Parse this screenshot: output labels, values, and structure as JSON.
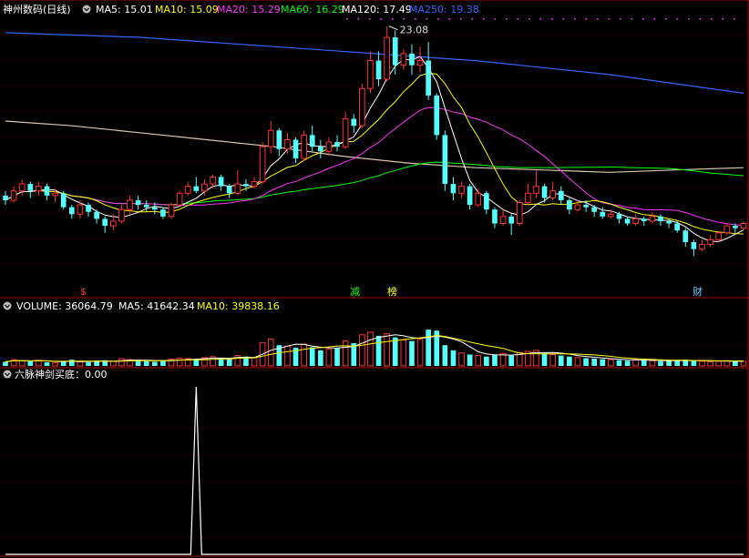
{
  "stock": {
    "name": "神州数码",
    "period": "(日线)"
  },
  "price_panel": {
    "ma_labels": [
      {
        "text": "MA5: 15.01",
        "color": "#ffffff"
      },
      {
        "text": "MA10: 15.09",
        "color": "#ffff00"
      },
      {
        "text": "MA20: 15.29",
        "color": "#ff33ff"
      },
      {
        "text": "MA60: 16.29",
        "color": "#00ff00"
      },
      {
        "text": "MA120: 17.49",
        "color": "#ffffff"
      },
      {
        "text": "MA250: 19.38",
        "color": "#3366ff"
      }
    ],
    "high_label": "23.08",
    "markers": [
      {
        "text": "$",
        "color": "#ff3333"
      },
      {
        "text": "减",
        "color": "#00ff00"
      },
      {
        "text": "榜",
        "color": "#ffff00"
      },
      {
        "text": "财",
        "color": "#66ccff"
      }
    ]
  },
  "volume_panel": {
    "labels": [
      {
        "text": "VOLUME: 36064.79",
        "color": "#ffffff"
      },
      {
        "text": "MA5: 41642.34",
        "color": "#ffffff"
      },
      {
        "text": "MA10: 39838.16",
        "color": "#ffff00"
      }
    ]
  },
  "indicator_panel": {
    "label": "六脉神剑买底：0.00",
    "color": "#ffffff"
  },
  "chart_data": {
    "type": "candlestick",
    "ylim": [
      12,
      23.5
    ],
    "candles": [
      [
        15.8,
        15.6,
        16.0,
        15.4
      ],
      [
        15.6,
        16.0,
        16.2,
        15.5
      ],
      [
        16.0,
        16.3,
        16.5,
        15.8
      ],
      [
        16.3,
        16.0,
        16.4,
        15.7
      ],
      [
        16.0,
        16.2,
        16.4,
        15.8
      ],
      [
        16.2,
        15.8,
        16.3,
        15.6
      ],
      [
        15.8,
        15.9,
        16.1,
        15.5
      ],
      [
        15.9,
        15.3,
        16.0,
        15.2
      ],
      [
        15.3,
        15.0,
        15.4,
        14.8
      ],
      [
        15.0,
        15.4,
        15.6,
        14.8
      ],
      [
        15.4,
        15.1,
        15.5,
        14.9
      ],
      [
        15.1,
        14.8,
        15.2,
        14.6
      ],
      [
        14.8,
        14.5,
        14.9,
        14.2
      ],
      [
        14.5,
        14.7,
        15.0,
        14.3
      ],
      [
        14.7,
        15.2,
        15.4,
        14.6
      ],
      [
        15.2,
        15.6,
        15.8,
        15.0
      ],
      [
        15.6,
        15.4,
        15.8,
        15.2
      ],
      [
        15.4,
        15.3,
        15.6,
        15.1
      ],
      [
        15.3,
        15.2,
        15.5,
        15.0
      ],
      [
        15.2,
        14.9,
        15.3,
        14.8
      ],
      [
        14.9,
        15.4,
        15.5,
        14.8
      ],
      [
        15.4,
        15.9,
        16.0,
        15.3
      ],
      [
        15.9,
        16.2,
        16.4,
        15.8
      ],
      [
        16.2,
        16.0,
        16.6,
        15.9
      ],
      [
        16.0,
        16.3,
        16.5,
        15.8
      ],
      [
        16.3,
        16.6,
        16.7,
        16.1
      ],
      [
        16.6,
        16.2,
        16.7,
        16.0
      ],
      [
        16.2,
        15.9,
        16.3,
        15.7
      ],
      [
        15.9,
        16.3,
        16.9,
        15.8
      ],
      [
        16.3,
        16.2,
        16.5,
        16.0
      ],
      [
        16.2,
        16.4,
        16.6,
        16.1
      ],
      [
        16.4,
        17.9,
        18.1,
        16.3
      ],
      [
        17.9,
        18.6,
        19.0,
        17.6
      ],
      [
        18.6,
        17.8,
        18.7,
        17.5
      ],
      [
        17.8,
        18.2,
        18.5,
        17.6
      ],
      [
        18.2,
        17.4,
        18.3,
        17.2
      ],
      [
        17.4,
        18.4,
        18.6,
        17.3
      ],
      [
        18.4,
        17.9,
        18.8,
        17.7
      ],
      [
        17.9,
        17.7,
        18.2,
        17.4
      ],
      [
        17.7,
        18.1,
        18.3,
        17.5
      ],
      [
        18.1,
        17.9,
        18.4,
        17.7
      ],
      [
        17.9,
        19.1,
        19.4,
        17.8
      ],
      [
        19.1,
        18.8,
        19.3,
        18.5
      ],
      [
        18.8,
        20.4,
        20.6,
        18.7
      ],
      [
        20.4,
        21.6,
        22.0,
        20.2
      ],
      [
        21.6,
        20.8,
        22.0,
        20.5
      ],
      [
        20.8,
        22.6,
        23.08,
        20.7
      ],
      [
        22.6,
        21.4,
        22.9,
        21.0
      ],
      [
        21.4,
        21.9,
        22.1,
        21.2
      ],
      [
        21.9,
        21.4,
        22.3,
        21.0
      ],
      [
        21.4,
        21.6,
        22.2,
        21.1
      ],
      [
        21.6,
        20.1,
        22.4,
        19.9
      ],
      [
        20.1,
        18.4,
        20.2,
        18.2
      ],
      [
        18.4,
        16.3,
        18.6,
        16.0
      ],
      [
        16.3,
        15.9,
        16.6,
        15.6
      ],
      [
        15.9,
        16.2,
        16.4,
        15.7
      ],
      [
        16.2,
        15.4,
        16.3,
        15.2
      ],
      [
        15.4,
        15.9,
        16.1,
        15.3
      ],
      [
        15.9,
        15.2,
        16.0,
        15.0
      ],
      [
        15.2,
        14.6,
        15.3,
        14.4
      ],
      [
        14.6,
        14.9,
        15.2,
        14.5
      ],
      [
        14.9,
        14.6,
        15.0,
        14.1
      ],
      [
        14.6,
        15.5,
        15.6,
        14.5
      ],
      [
        15.5,
        15.9,
        16.3,
        15.4
      ],
      [
        15.9,
        16.2,
        16.9,
        15.7
      ],
      [
        16.2,
        15.7,
        16.3,
        15.5
      ],
      [
        15.7,
        16.0,
        16.4,
        15.6
      ],
      [
        16.0,
        15.6,
        16.2,
        15.4
      ],
      [
        15.6,
        15.2,
        15.7,
        15.0
      ],
      [
        15.2,
        15.4,
        15.6,
        15.1
      ],
      [
        15.4,
        15.3,
        15.6,
        15.1
      ],
      [
        15.3,
        15.1,
        15.4,
        14.9
      ],
      [
        15.1,
        14.9,
        15.3,
        14.8
      ],
      [
        14.9,
        15.0,
        15.2,
        14.8
      ],
      [
        15.0,
        14.8,
        15.1,
        14.6
      ],
      [
        14.8,
        14.6,
        14.9,
        14.5
      ],
      [
        14.6,
        14.8,
        15.0,
        14.5
      ],
      [
        14.8,
        14.7,
        14.9,
        14.5
      ],
      [
        14.7,
        14.9,
        15.1,
        14.6
      ],
      [
        14.9,
        14.7,
        15.0,
        14.5
      ],
      [
        14.7,
        14.6,
        14.8,
        14.4
      ],
      [
        14.6,
        14.3,
        14.7,
        14.2
      ],
      [
        14.3,
        13.8,
        14.4,
        13.6
      ],
      [
        13.8,
        13.5,
        13.9,
        13.2
      ],
      [
        13.5,
        13.7,
        13.9,
        13.4
      ],
      [
        13.7,
        13.9,
        14.1,
        13.6
      ],
      [
        13.9,
        14.2,
        14.3,
        13.8
      ],
      [
        14.2,
        14.5,
        14.6,
        14.1
      ],
      [
        14.5,
        14.4,
        14.6,
        14.2
      ],
      [
        14.4,
        14.6,
        14.7,
        14.3
      ]
    ],
    "ma_series": [
      {
        "name": "MA5",
        "color": "#ffffff"
      },
      {
        "name": "MA10",
        "color": "#ffff00"
      },
      {
        "name": "MA20",
        "color": "#ff33ff"
      },
      {
        "name": "MA60",
        "color": "#00ff00"
      },
      {
        "name": "MA120",
        "color": "#ffffff"
      },
      {
        "name": "MA250",
        "color": "#3366ff"
      }
    ],
    "ma120_points": [
      19.0,
      18.8,
      18.5,
      18.2,
      17.9,
      17.5,
      17.2,
      17.0,
      16.9,
      16.8,
      16.9,
      17.0
    ],
    "ma250_points": [
      22.8,
      22.7,
      22.6,
      22.4,
      22.2,
      22.0,
      21.8,
      21.6,
      21.3,
      21.0,
      20.6,
      20.2
    ],
    "volume_ylim": [
      0,
      100000
    ],
    "volume": [
      8000,
      12000,
      10000,
      9000,
      11000,
      7000,
      6000,
      9000,
      12000,
      8000,
      7000,
      10000,
      11000,
      9000,
      14000,
      12000,
      10000,
      9000,
      8000,
      11000,
      13000,
      15000,
      14000,
      12000,
      16000,
      18000,
      15000,
      13000,
      20000,
      18000,
      16000,
      45000,
      52000,
      40000,
      38000,
      35000,
      42000,
      36000,
      30000,
      32000,
      34000,
      48000,
      44000,
      60000,
      65000,
      58000,
      62000,
      55000,
      50000,
      48000,
      52000,
      70000,
      68000,
      40000,
      30000,
      25000,
      22000,
      20000,
      18000,
      22000,
      24000,
      20000,
      26000,
      28000,
      30000,
      24000,
      22000,
      20000,
      18000,
      16000,
      15000,
      14000,
      13000,
      12000,
      11000,
      10000,
      12000,
      11000,
      10000,
      9000,
      10000,
      11000,
      12000,
      10000,
      9000,
      8000,
      9000,
      10000,
      9000,
      9000
    ],
    "indicator": {
      "spike_index": 23,
      "spike_value": 1.0
    }
  }
}
